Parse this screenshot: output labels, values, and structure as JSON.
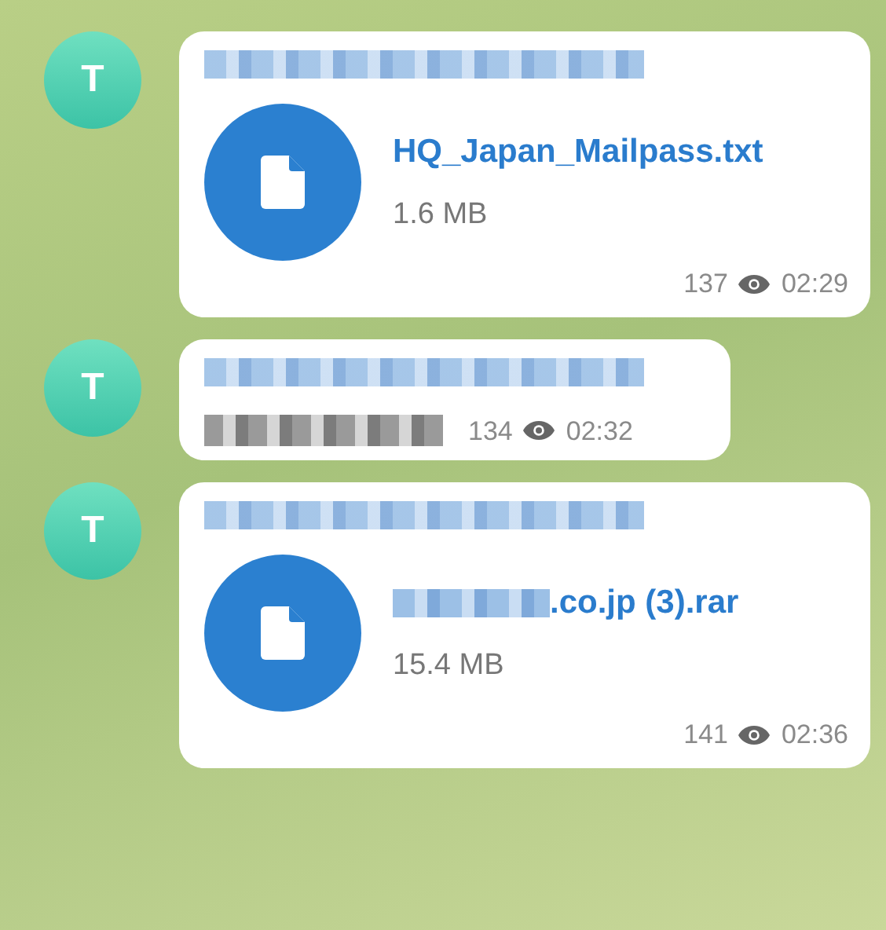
{
  "messages": [
    {
      "avatar": "T",
      "kind": "file",
      "sender_redacted": true,
      "file_name_redacted_prefix": false,
      "file_name": "HQ_Japan_Mailpass.txt",
      "file_size": "1.6 MB",
      "views": "137",
      "time": "02:29"
    },
    {
      "avatar": "T",
      "kind": "text",
      "sender_redacted": true,
      "text_redacted": true,
      "views": "134",
      "time": "02:32"
    },
    {
      "avatar": "T",
      "kind": "file",
      "sender_redacted": true,
      "file_name_redacted_prefix": true,
      "file_name": ".co.jp (3).rar",
      "file_size": "15.4 MB",
      "views": "141",
      "time": "02:36"
    }
  ]
}
